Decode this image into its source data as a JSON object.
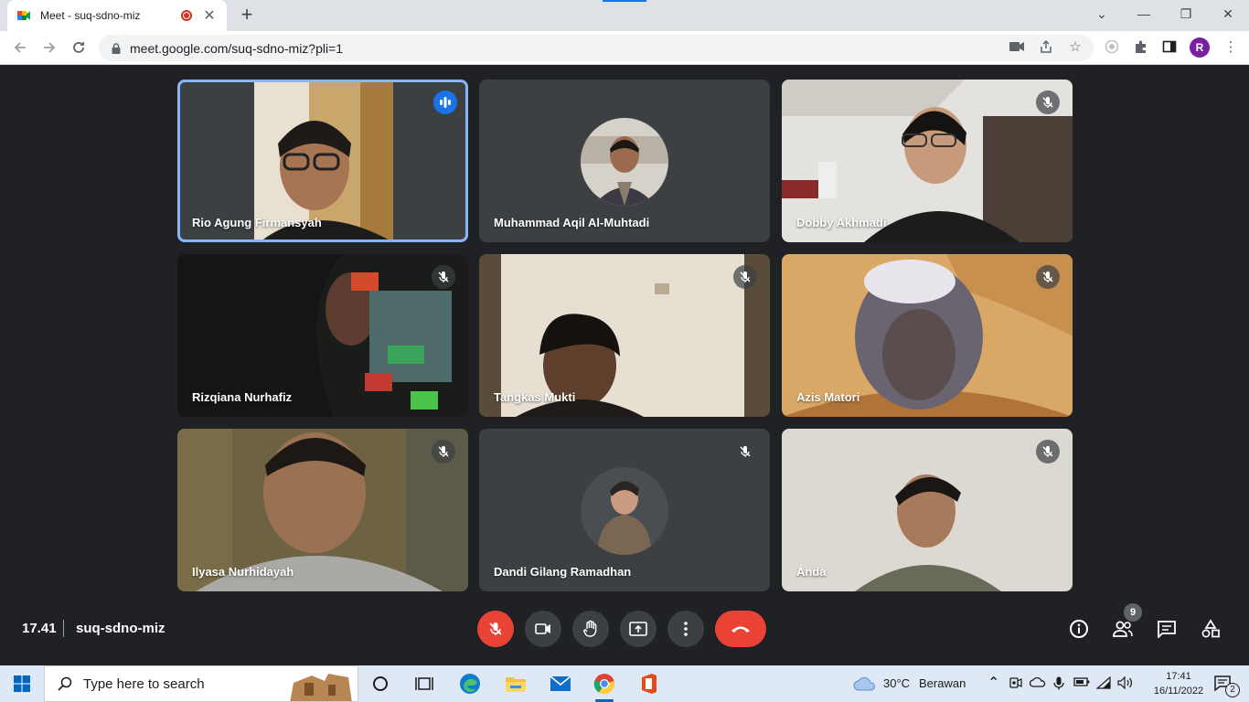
{
  "browser": {
    "tab_title": "Meet - suq-sdno-miz",
    "url": "meet.google.com/suq-sdno-miz?pli=1",
    "profile_initial": "R"
  },
  "meeting": {
    "time": "17.41",
    "code": "suq-sdno-miz",
    "people_count": "9"
  },
  "participants": [
    {
      "name": "Rio Agung Firmansyah",
      "muted": false,
      "speaking": true
    },
    {
      "name": "Muhammad Aqil Al-Muhtadi",
      "muted": false,
      "speaking": false
    },
    {
      "name": "Dobby Akhmadi",
      "muted": true,
      "speaking": false
    },
    {
      "name": "Rizqiana Nurhafiz",
      "muted": true,
      "speaking": false
    },
    {
      "name": "Tangkas Mukti",
      "muted": true,
      "speaking": false
    },
    {
      "name": "Azis Matori",
      "muted": true,
      "speaking": false
    },
    {
      "name": "Ilyasa Nurhidayah",
      "muted": true,
      "speaking": false
    },
    {
      "name": "Dandi Gilang Ramadhan",
      "muted": true,
      "speaking": false
    },
    {
      "name": "Anda",
      "muted": true,
      "speaking": false
    }
  ],
  "taskbar": {
    "search_placeholder": "Type here to search",
    "weather_temp": "30°C",
    "weather_desc": "Berawan",
    "clock_time": "17:41",
    "clock_date": "16/11/2022",
    "notification_count": "2"
  },
  "colors": {
    "meet_bg": "#202124",
    "tile_bg": "#3c4043",
    "accent_blue": "#1a73e8",
    "active_outline": "#8ab4f8",
    "end_call_red": "#ea4335"
  }
}
